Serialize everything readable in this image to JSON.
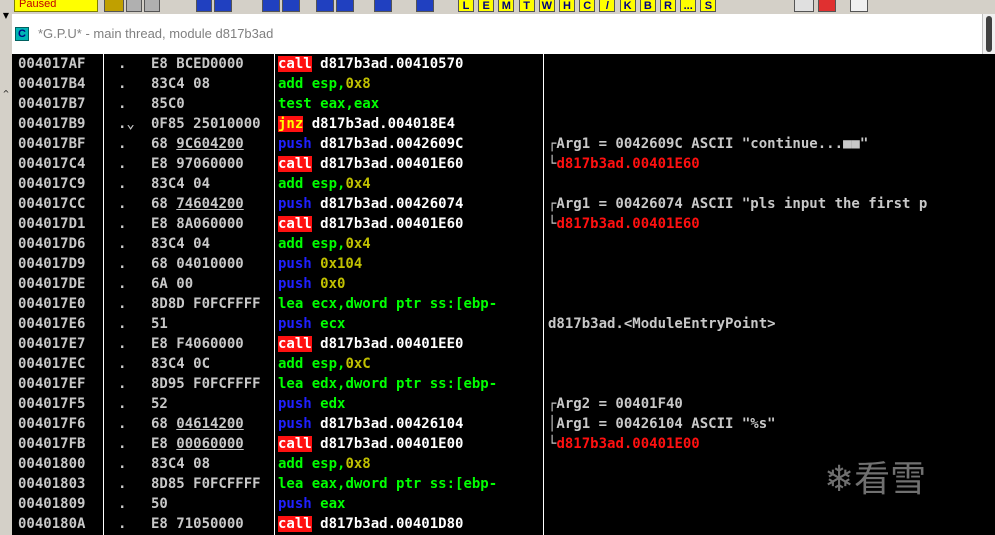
{
  "toolbar": {
    "status": "Paused",
    "letter_buttons": [
      "L",
      "E",
      "M",
      "T",
      "W",
      "H",
      "C",
      "/",
      "K",
      "B",
      "R",
      "...",
      "S"
    ]
  },
  "window": {
    "icon_letter": "C",
    "title": "*G.P.U* - main thread, module d817b3ad"
  },
  "rows": [
    {
      "addr": "004017AF",
      "flag": ".",
      "hex": "E8 BCED0000",
      "op": "call",
      "opclass": "op-call",
      "args": [
        {
          "t": " d817b3ad.00410570",
          "c": "arg-r"
        }
      ],
      "comment": []
    },
    {
      "addr": "004017B4",
      "flag": ".",
      "hex": "83C4 08",
      "op": "add",
      "opclass": "op-green",
      "args": [
        {
          "t": " esp,",
          "c": "op-green"
        },
        {
          "t": "0x8",
          "c": "arg-y"
        }
      ],
      "comment": []
    },
    {
      "addr": "004017B7",
      "flag": ".",
      "hex": "85C0",
      "op": "test",
      "opclass": "op-green",
      "args": [
        {
          "t": " eax,eax",
          "c": "op-green"
        }
      ],
      "comment": []
    },
    {
      "addr": "004017B9",
      "flag": ".⌄",
      "hex": "0F85 25010000",
      "op": "jnz",
      "opclass": "op-jnz",
      "args": [
        {
          "t": " d817b3ad.004018E4",
          "c": "arg-r"
        }
      ],
      "comment": []
    },
    {
      "addr": "004017BF",
      "flag": ".",
      "hex": "68 9C604200",
      "hexu": "9C604200",
      "op": "push",
      "opclass": "op-push",
      "args": [
        {
          "t": " d817b3ad.0042609C",
          "c": "arg-r"
        }
      ],
      "comment": [
        {
          "t": "┌Arg1 = 0042609C ASCII \"continue...■■\"",
          "c": "brk"
        }
      ]
    },
    {
      "addr": "004017C4",
      "flag": ".",
      "hex": "E8 97060000",
      "op": "call",
      "opclass": "op-call",
      "args": [
        {
          "t": " d817b3ad.00401E60",
          "c": "arg-r"
        }
      ],
      "comment": [
        {
          "t": "└",
          "c": "brk"
        },
        {
          "t": "d817b3ad.00401E60",
          "c": "cm-red"
        }
      ]
    },
    {
      "addr": "004017C9",
      "flag": ".",
      "hex": "83C4 04",
      "op": "add",
      "opclass": "op-green",
      "args": [
        {
          "t": " esp,",
          "c": "op-green"
        },
        {
          "t": "0x4",
          "c": "arg-y"
        }
      ],
      "comment": []
    },
    {
      "addr": "004017CC",
      "flag": ".",
      "hex": "68 74604200",
      "hexu": "74604200",
      "op": "push",
      "opclass": "op-push",
      "args": [
        {
          "t": " d817b3ad.00426074",
          "c": "arg-r"
        }
      ],
      "comment": [
        {
          "t": "┌Arg1 = 00426074 ASCII \"pls input the first p",
          "c": "brk"
        }
      ]
    },
    {
      "addr": "004017D1",
      "flag": ".",
      "hex": "E8 8A060000",
      "op": "call",
      "opclass": "op-call",
      "args": [
        {
          "t": " d817b3ad.00401E60",
          "c": "arg-r"
        }
      ],
      "comment": [
        {
          "t": "└",
          "c": "brk"
        },
        {
          "t": "d817b3ad.00401E60",
          "c": "cm-red"
        }
      ]
    },
    {
      "addr": "004017D6",
      "flag": ".",
      "hex": "83C4 04",
      "op": "add",
      "opclass": "op-green",
      "args": [
        {
          "t": " esp,",
          "c": "op-green"
        },
        {
          "t": "0x4",
          "c": "arg-y"
        }
      ],
      "comment": []
    },
    {
      "addr": "004017D9",
      "flag": ".",
      "hex": "68 04010000",
      "op": "push",
      "opclass": "op-push",
      "args": [
        {
          "t": " 0x104",
          "c": "arg-y"
        }
      ],
      "comment": []
    },
    {
      "addr": "004017DE",
      "flag": ".",
      "hex": "6A 00",
      "op": "push",
      "opclass": "op-push",
      "args": [
        {
          "t": " 0x0",
          "c": "arg-y"
        }
      ],
      "comment": []
    },
    {
      "addr": "004017E0",
      "flag": ".",
      "hex": "8D8D F0FCFFFF",
      "op": "lea",
      "opclass": "op-green",
      "args": [
        {
          "t": " ecx,dword ptr ss:[ebp-",
          "c": "op-green"
        }
      ],
      "comment": []
    },
    {
      "addr": "004017E6",
      "flag": ".",
      "hex": "51",
      "op": "push",
      "opclass": "op-push",
      "args": [
        {
          "t": " ecx",
          "c": "op-green"
        }
      ],
      "comment": [
        {
          "t": " d817b3ad.<ModuleEntryPoint>",
          "c": "brk"
        }
      ]
    },
    {
      "addr": "004017E7",
      "flag": ".",
      "hex": "E8 F4060000",
      "op": "call",
      "opclass": "op-call",
      "args": [
        {
          "t": " d817b3ad.00401EE0",
          "c": "arg-r"
        }
      ],
      "comment": []
    },
    {
      "addr": "004017EC",
      "flag": ".",
      "hex": "83C4 0C",
      "op": "add",
      "opclass": "op-green",
      "args": [
        {
          "t": " esp,",
          "c": "op-green"
        },
        {
          "t": "0xC",
          "c": "arg-y"
        }
      ],
      "comment": []
    },
    {
      "addr": "004017EF",
      "flag": ".",
      "hex": "8D95 F0FCFFFF",
      "op": "lea",
      "opclass": "op-green",
      "args": [
        {
          "t": " edx,dword ptr ss:[ebp-",
          "c": "op-green"
        }
      ],
      "comment": []
    },
    {
      "addr": "004017F5",
      "flag": ".",
      "hex": "52",
      "op": "push",
      "opclass": "op-push",
      "args": [
        {
          "t": " edx",
          "c": "op-green"
        }
      ],
      "comment": [
        {
          "t": "┌Arg2 = 00401F40",
          "c": "brk"
        }
      ]
    },
    {
      "addr": "004017F6",
      "flag": ".",
      "hex": "68 04614200",
      "hexu": "04614200",
      "op": "push",
      "opclass": "op-push",
      "args": [
        {
          "t": " d817b3ad.00426104",
          "c": "arg-r"
        }
      ],
      "comment": [
        {
          "t": "│Arg1 = 00426104 ASCII \"%s\"",
          "c": "brk"
        }
      ]
    },
    {
      "addr": "004017FB",
      "flag": ".",
      "hex": "E8 00060000",
      "hexu": "00060000",
      "op": "call",
      "opclass": "op-call",
      "args": [
        {
          "t": " d817b3ad.00401E00",
          "c": "arg-r"
        }
      ],
      "comment": [
        {
          "t": "└",
          "c": "brk"
        },
        {
          "t": "d817b3ad.00401E00",
          "c": "cm-red"
        }
      ]
    },
    {
      "addr": "00401800",
      "flag": ".",
      "hex": "83C4 08",
      "op": "add",
      "opclass": "op-green",
      "args": [
        {
          "t": " esp,",
          "c": "op-green"
        },
        {
          "t": "0x8",
          "c": "arg-y"
        }
      ],
      "comment": []
    },
    {
      "addr": "00401803",
      "flag": ".",
      "hex": "8D85 F0FCFFFF",
      "op": "lea",
      "opclass": "op-green",
      "args": [
        {
          "t": " eax,dword ptr ss:[ebp-",
          "c": "op-green"
        }
      ],
      "comment": []
    },
    {
      "addr": "00401809",
      "flag": ".",
      "hex": "50",
      "op": "push",
      "opclass": "op-push",
      "args": [
        {
          "t": " eax",
          "c": "op-green"
        }
      ],
      "comment": []
    },
    {
      "addr": "0040180A",
      "flag": ".",
      "hex": "E8 71050000",
      "op": "call",
      "opclass": "op-call",
      "args": [
        {
          "t": " d817b3ad.00401D80",
          "c": "arg-r"
        }
      ],
      "comment": []
    }
  ],
  "watermark": "❄看雪"
}
